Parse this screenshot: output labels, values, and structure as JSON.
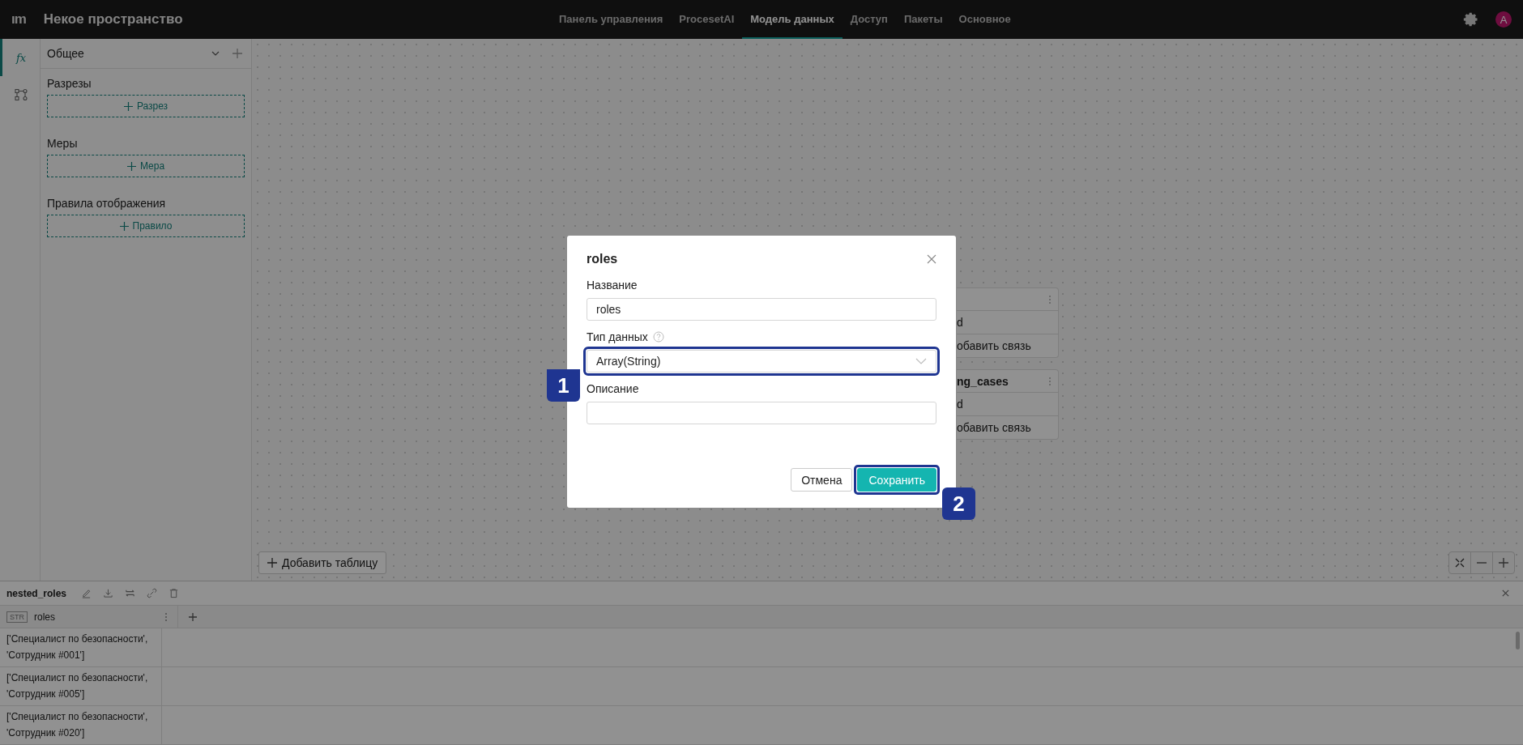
{
  "app": {
    "logo": "ım",
    "title": "Некое пространство"
  },
  "nav": [
    {
      "label": "Панель управления",
      "selected": false
    },
    {
      "label": "ProcesetAI",
      "selected": false
    },
    {
      "label": "Модель данных",
      "selected": true
    },
    {
      "label": "Доступ",
      "selected": false
    },
    {
      "label": "Пакеты",
      "selected": false
    },
    {
      "label": "Основное",
      "selected": false
    }
  ],
  "user": {
    "avatar": "A"
  },
  "rail": [
    {
      "kind": "formula",
      "label": "fx",
      "selected": true
    },
    {
      "kind": "graph",
      "selected": false
    }
  ],
  "sidebar": {
    "group": "Общее",
    "sections": [
      {
        "title": "Разрезы",
        "button": "Разрез"
      },
      {
        "title": "Меры",
        "button": "Мера"
      },
      {
        "title": "Правила отображения",
        "button": "Правило"
      }
    ]
  },
  "canvas": {
    "tables": [
      {
        "rows": [
          "d",
          "обавить связь"
        ]
      },
      {
        "title": "ng_cases",
        "rows": [
          "d",
          "обавить связь"
        ]
      }
    ],
    "add_table_button": "Добавить таблицу"
  },
  "dialog": {
    "title": "roles",
    "fields": [
      {
        "kind": "text",
        "label": "Название",
        "value": "roles"
      },
      {
        "kind": "select",
        "label": "Тип данных",
        "help": true,
        "value": "Array(String)",
        "callout": "1"
      },
      {
        "kind": "text",
        "label": "Описание"
      }
    ],
    "buttons": [
      {
        "kind": "secondary",
        "label": "Отмена"
      },
      {
        "kind": "primary",
        "label": "Сохранить",
        "callout": "2"
      }
    ]
  },
  "bottom": {
    "table_name": "nested_roles",
    "columns": [
      {
        "type": "STR",
        "name": "roles"
      }
    ],
    "rows": [
      "['Специалист по безопасности', 'Сотрудник #001']",
      "['Специалист по безопасности', 'Сотрудник #005']",
      "['Специалист по безопасности', 'Сотрудник #020']"
    ]
  }
}
